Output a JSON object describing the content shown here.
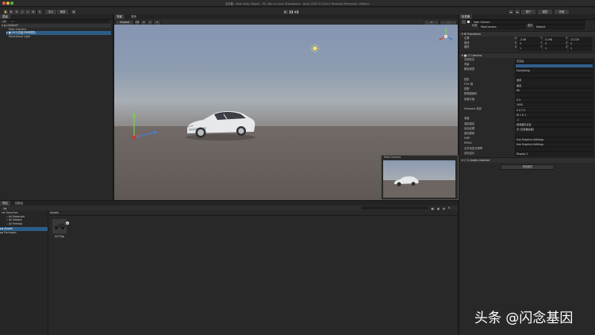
{
  "window": {
    "title": "无标题 - New Unity Project - PC, Mac & Linux Standalone - Unity 2020.3.11f1c1 Personal (Personal) <Metal>"
  },
  "toolbar": {
    "pivot_label": "中心",
    "local_label": "局部",
    "account_label": "账户",
    "layers_label": "图层",
    "layout_label": "布局"
  },
  "hierarchy": {
    "tab": "层级",
    "search_placeholder": "All",
    "scene": "Untitled*",
    "items": [
      "Main Camera",
      "SU7(已经·PBR材质)",
      "Directional Light"
    ]
  },
  "scene_view": {
    "tabs": [
      "场景",
      "游戏"
    ],
    "shading_mode": "Shaded",
    "preview_title": "Main Camera"
  },
  "project": {
    "tabs": [
      "项目",
      "控制台"
    ],
    "favorites_label": "Favorites",
    "favorites": [
      "All Materials",
      "All Models",
      "All Prefabs"
    ],
    "assets_label": "Assets",
    "packages_label": "Packages",
    "breadcrumb": "Assets",
    "asset_name": "SU7汽车",
    "count": "9"
  },
  "inspector": {
    "tab": "检查器",
    "object_name": "Main Camera",
    "tag_label": "标签",
    "tag_value": "MainCamera",
    "layer_label": "图层",
    "layer_value": "Default",
    "transform": {
      "header": "Transform",
      "rows": [
        {
          "label": "位置",
          "x": "-2.06",
          "y": "0.198",
          "z": "12.226"
        },
        {
          "label": "旋转",
          "x": "0",
          "y": "0",
          "z": "0"
        },
        {
          "label": "缩放",
          "x": "1",
          "y": "1",
          "z": "1"
        }
      ]
    },
    "camera": {
      "header": "Camera",
      "rows": [
        {
          "label": "清除标志",
          "value": "天空盒"
        },
        {
          "label": "背景",
          "value": ""
        },
        {
          "label": "剔除遮罩",
          "value": "Everything"
        },
        {
          "label": "",
          "value": ""
        },
        {
          "label": "投影",
          "value": "透视"
        },
        {
          "label": "FOV 轴",
          "value": "垂直"
        },
        {
          "label": "视野",
          "value": "60"
        },
        {
          "label": "物理摄像机",
          "value": ""
        },
        {
          "label": "剪裁平面",
          "value": "0.3"
        },
        {
          "label": "",
          "value": "1000"
        },
        {
          "label": "Viewport 矩形",
          "value": "X 0   Y 0"
        },
        {
          "label": "",
          "value": "W 1   H 1"
        },
        {
          "label": "深度",
          "value": "-1"
        },
        {
          "label": "渲染路径",
          "value": "使用图形设置"
        },
        {
          "label": "目标纹理",
          "value": "无 (渲染器纹理)"
        },
        {
          "label": "遮挡剔除",
          "value": ""
        },
        {
          "label": "HDR",
          "value": "Use Graphics Settings"
        },
        {
          "label": "MSAA",
          "value": "Use Graphics Settings"
        },
        {
          "label": "允许动态分辨率",
          "value": ""
        },
        {
          "label": "目标显示",
          "value": "Display 1"
        }
      ]
    },
    "audio_listener": {
      "header": "Audio Listener"
    },
    "add_component_label": "添加组件"
  },
  "watermark": {
    "text": "头条 @闪念基因"
  }
}
